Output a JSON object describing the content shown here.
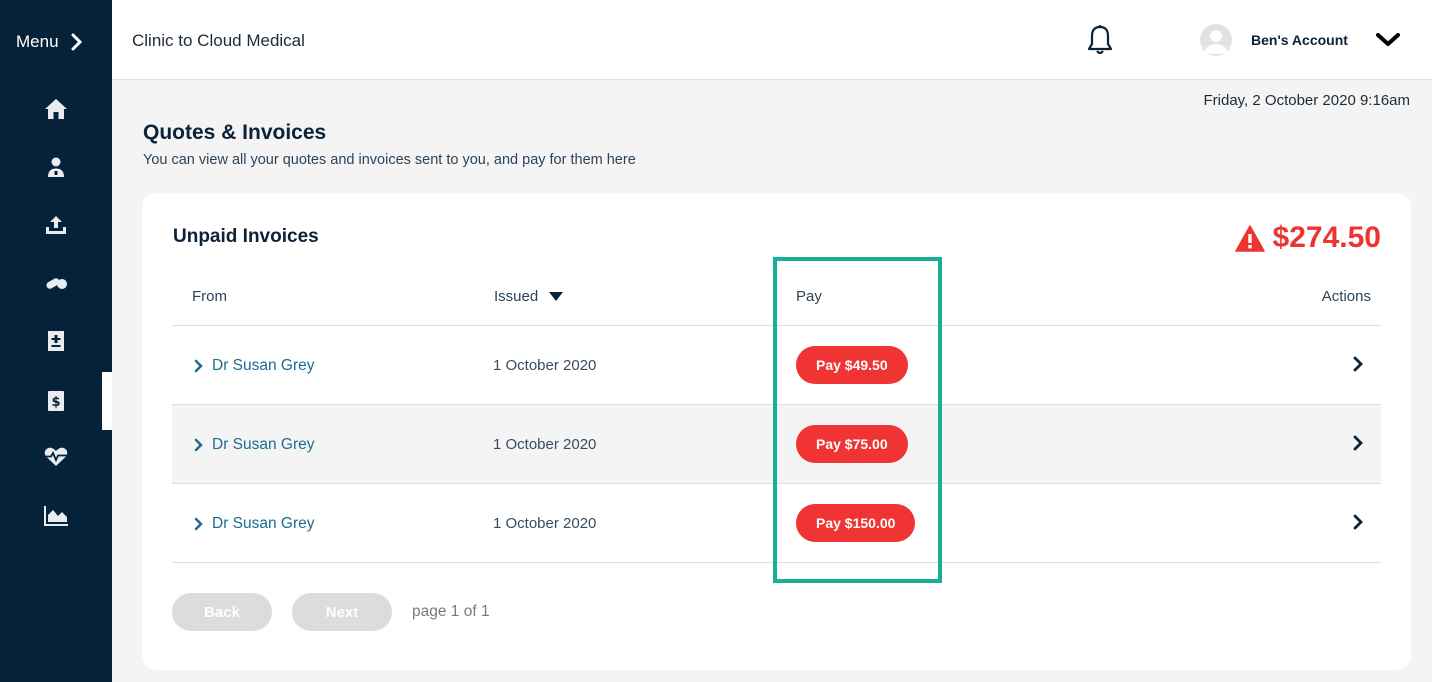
{
  "sidebar": {
    "menu_label": "Menu",
    "items": [
      {
        "icon": "home-icon"
      },
      {
        "icon": "doctor-icon"
      },
      {
        "icon": "upload-icon"
      },
      {
        "icon": "pills-icon"
      },
      {
        "icon": "medical-record-icon"
      },
      {
        "icon": "invoice-icon"
      },
      {
        "icon": "heartbeat-icon"
      },
      {
        "icon": "chart-area-icon"
      }
    ],
    "active_index": 5
  },
  "header": {
    "brand": "Clinic to Cloud Medical",
    "account_name": "Ben's Account"
  },
  "datetime": "Friday, 2 October 2020 9:16am",
  "page": {
    "title": "Quotes & Invoices",
    "subtitle": "You can view all your quotes and invoices sent to you, and pay for them here"
  },
  "card": {
    "title": "Unpaid Invoices",
    "total": "$274.50",
    "columns": {
      "from": "From",
      "issued": "Issued",
      "pay": "Pay",
      "actions": "Actions"
    },
    "rows": [
      {
        "from": "Dr Susan Grey",
        "issued": "1 October 2020",
        "pay": "Pay $49.50"
      },
      {
        "from": "Dr Susan Grey",
        "issued": "1 October 2020",
        "pay": "Pay $75.00"
      },
      {
        "from": "Dr Susan Grey",
        "issued": "1 October 2020",
        "pay": "Pay $150.00"
      }
    ],
    "pager": {
      "back": "Back",
      "next": "Next",
      "info": "page 1 of 1"
    }
  },
  "colors": {
    "sidebar_bg": "#062238",
    "accent_red": "#f03434",
    "link_blue": "#1a6d91",
    "highlight_teal": "#17ae9a"
  }
}
